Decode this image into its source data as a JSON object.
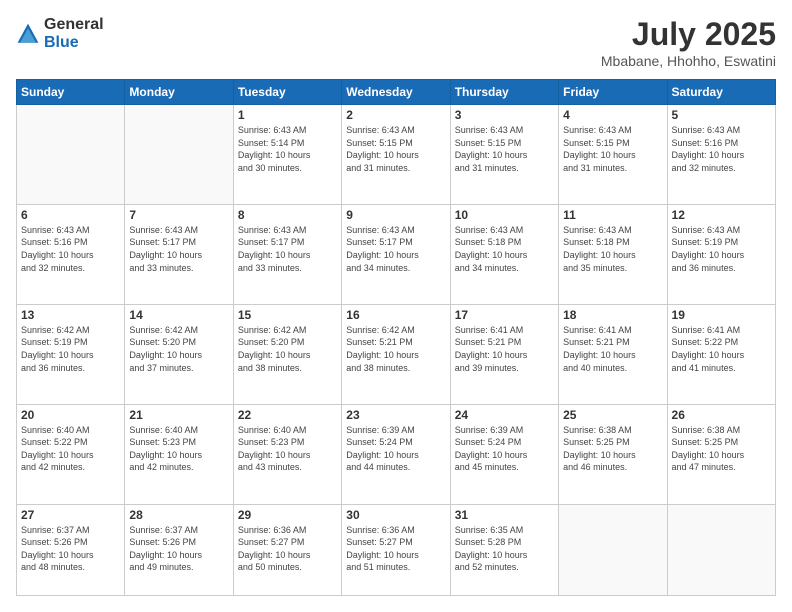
{
  "header": {
    "logo_line1": "General",
    "logo_line2": "Blue",
    "month_year": "July 2025",
    "location": "Mbabane, Hhohho, Eswatini"
  },
  "weekdays": [
    "Sunday",
    "Monday",
    "Tuesday",
    "Wednesday",
    "Thursday",
    "Friday",
    "Saturday"
  ],
  "weeks": [
    [
      {
        "day": "",
        "content": ""
      },
      {
        "day": "",
        "content": ""
      },
      {
        "day": "1",
        "content": "Sunrise: 6:43 AM\nSunset: 5:14 PM\nDaylight: 10 hours\nand 30 minutes."
      },
      {
        "day": "2",
        "content": "Sunrise: 6:43 AM\nSunset: 5:15 PM\nDaylight: 10 hours\nand 31 minutes."
      },
      {
        "day": "3",
        "content": "Sunrise: 6:43 AM\nSunset: 5:15 PM\nDaylight: 10 hours\nand 31 minutes."
      },
      {
        "day": "4",
        "content": "Sunrise: 6:43 AM\nSunset: 5:15 PM\nDaylight: 10 hours\nand 31 minutes."
      },
      {
        "day": "5",
        "content": "Sunrise: 6:43 AM\nSunset: 5:16 PM\nDaylight: 10 hours\nand 32 minutes."
      }
    ],
    [
      {
        "day": "6",
        "content": "Sunrise: 6:43 AM\nSunset: 5:16 PM\nDaylight: 10 hours\nand 32 minutes."
      },
      {
        "day": "7",
        "content": "Sunrise: 6:43 AM\nSunset: 5:17 PM\nDaylight: 10 hours\nand 33 minutes."
      },
      {
        "day": "8",
        "content": "Sunrise: 6:43 AM\nSunset: 5:17 PM\nDaylight: 10 hours\nand 33 minutes."
      },
      {
        "day": "9",
        "content": "Sunrise: 6:43 AM\nSunset: 5:17 PM\nDaylight: 10 hours\nand 34 minutes."
      },
      {
        "day": "10",
        "content": "Sunrise: 6:43 AM\nSunset: 5:18 PM\nDaylight: 10 hours\nand 34 minutes."
      },
      {
        "day": "11",
        "content": "Sunrise: 6:43 AM\nSunset: 5:18 PM\nDaylight: 10 hours\nand 35 minutes."
      },
      {
        "day": "12",
        "content": "Sunrise: 6:43 AM\nSunset: 5:19 PM\nDaylight: 10 hours\nand 36 minutes."
      }
    ],
    [
      {
        "day": "13",
        "content": "Sunrise: 6:42 AM\nSunset: 5:19 PM\nDaylight: 10 hours\nand 36 minutes."
      },
      {
        "day": "14",
        "content": "Sunrise: 6:42 AM\nSunset: 5:20 PM\nDaylight: 10 hours\nand 37 minutes."
      },
      {
        "day": "15",
        "content": "Sunrise: 6:42 AM\nSunset: 5:20 PM\nDaylight: 10 hours\nand 38 minutes."
      },
      {
        "day": "16",
        "content": "Sunrise: 6:42 AM\nSunset: 5:21 PM\nDaylight: 10 hours\nand 38 minutes."
      },
      {
        "day": "17",
        "content": "Sunrise: 6:41 AM\nSunset: 5:21 PM\nDaylight: 10 hours\nand 39 minutes."
      },
      {
        "day": "18",
        "content": "Sunrise: 6:41 AM\nSunset: 5:21 PM\nDaylight: 10 hours\nand 40 minutes."
      },
      {
        "day": "19",
        "content": "Sunrise: 6:41 AM\nSunset: 5:22 PM\nDaylight: 10 hours\nand 41 minutes."
      }
    ],
    [
      {
        "day": "20",
        "content": "Sunrise: 6:40 AM\nSunset: 5:22 PM\nDaylight: 10 hours\nand 42 minutes."
      },
      {
        "day": "21",
        "content": "Sunrise: 6:40 AM\nSunset: 5:23 PM\nDaylight: 10 hours\nand 42 minutes."
      },
      {
        "day": "22",
        "content": "Sunrise: 6:40 AM\nSunset: 5:23 PM\nDaylight: 10 hours\nand 43 minutes."
      },
      {
        "day": "23",
        "content": "Sunrise: 6:39 AM\nSunset: 5:24 PM\nDaylight: 10 hours\nand 44 minutes."
      },
      {
        "day": "24",
        "content": "Sunrise: 6:39 AM\nSunset: 5:24 PM\nDaylight: 10 hours\nand 45 minutes."
      },
      {
        "day": "25",
        "content": "Sunrise: 6:38 AM\nSunset: 5:25 PM\nDaylight: 10 hours\nand 46 minutes."
      },
      {
        "day": "26",
        "content": "Sunrise: 6:38 AM\nSunset: 5:25 PM\nDaylight: 10 hours\nand 47 minutes."
      }
    ],
    [
      {
        "day": "27",
        "content": "Sunrise: 6:37 AM\nSunset: 5:26 PM\nDaylight: 10 hours\nand 48 minutes."
      },
      {
        "day": "28",
        "content": "Sunrise: 6:37 AM\nSunset: 5:26 PM\nDaylight: 10 hours\nand 49 minutes."
      },
      {
        "day": "29",
        "content": "Sunrise: 6:36 AM\nSunset: 5:27 PM\nDaylight: 10 hours\nand 50 minutes."
      },
      {
        "day": "30",
        "content": "Sunrise: 6:36 AM\nSunset: 5:27 PM\nDaylight: 10 hours\nand 51 minutes."
      },
      {
        "day": "31",
        "content": "Sunrise: 6:35 AM\nSunset: 5:28 PM\nDaylight: 10 hours\nand 52 minutes."
      },
      {
        "day": "",
        "content": ""
      },
      {
        "day": "",
        "content": ""
      }
    ]
  ]
}
